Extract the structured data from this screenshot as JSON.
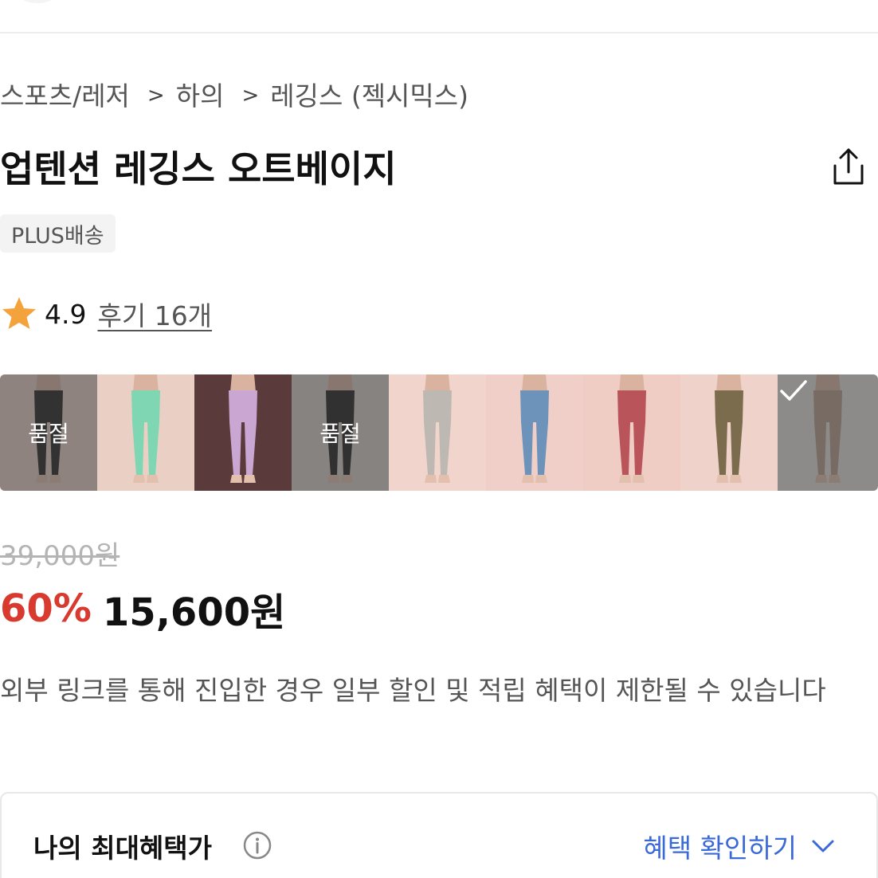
{
  "breadcrumb": {
    "items": [
      "스포츠/레저",
      "하의",
      "레깅스 (젝시믹스)"
    ],
    "separator": ">"
  },
  "product": {
    "title": "업텐션 레깅스 오트베이지",
    "badge": "PLUS배송"
  },
  "rating": {
    "score": "4.9",
    "reviews": "후기 16개",
    "star_color": "#F4A23B"
  },
  "variants": [
    {
      "name": "black",
      "status": "품절",
      "color": "#1c1c1c",
      "bg": "#e6cfc6"
    },
    {
      "name": "mint",
      "status": "",
      "color": "#7fd6b3",
      "bg": "#e9cfc4"
    },
    {
      "name": "lavender",
      "status": "",
      "color": "#c9a7d2",
      "bg": "#5a3a3a"
    },
    {
      "name": "black-2",
      "status": "품절",
      "color": "#1a1a1a",
      "bg": "#d8cfc9"
    },
    {
      "name": "gray",
      "status": "",
      "color": "#bdb8b2",
      "bg": "#f1d5cc"
    },
    {
      "name": "blue",
      "status": "",
      "color": "#6d93bb",
      "bg": "#efcfc7"
    },
    {
      "name": "red",
      "status": "",
      "color": "#b8545a",
      "bg": "#f0cdc4"
    },
    {
      "name": "olive",
      "status": "",
      "color": "#7c6c4e",
      "bg": "#efd2c9"
    },
    {
      "name": "oat-beige",
      "status": "selected",
      "color": "#b59a88",
      "bg": "#e3e0dc"
    }
  ],
  "price": {
    "original": "39,000원",
    "discount": "60%",
    "sale": "15,600원",
    "discount_color": "#D93A2F"
  },
  "notice": "외부 링크를 통해 진입한 경우 일부 할인 및 적립 혜택이 제한될 수 있습니다",
  "benefit": {
    "title": "나의 최대혜택가",
    "link": "혜택 확인하기",
    "link_color": "#3A69D8"
  }
}
